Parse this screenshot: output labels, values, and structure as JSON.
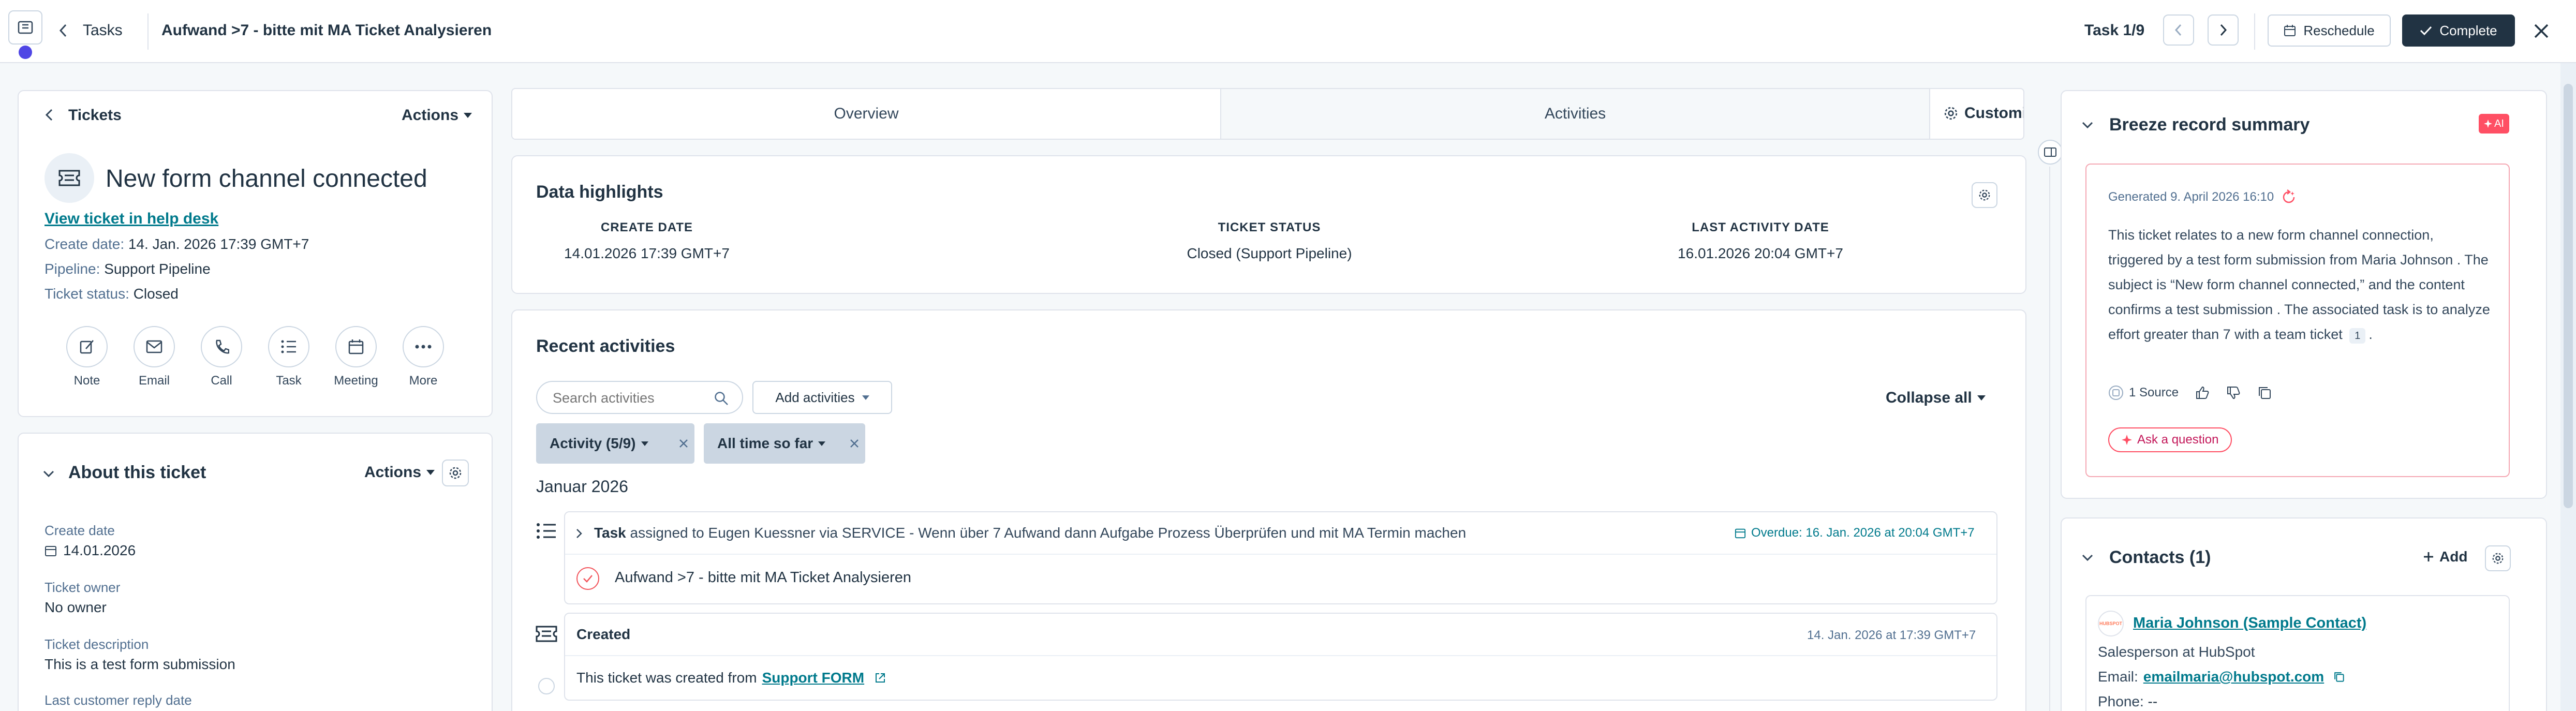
{
  "topbar": {
    "back_label": "Tasks",
    "task_title": "Aufwand >7 - bitte mit MA Ticket Analysieren",
    "task_counter": "Task 1/9",
    "reschedule_label": "Reschedule",
    "complete_label": "Complete"
  },
  "ticket_card": {
    "back_label": "Tickets",
    "actions_label": "Actions",
    "title": "New form channel connected",
    "help_desk_link": "View ticket in help desk",
    "create_date_label": "Create date:",
    "create_date_value": "14. Jan. 2026 17:39 GMT+7",
    "pipeline_label": "Pipeline:",
    "pipeline_value": "Support Pipeline",
    "status_label": "Ticket status:",
    "status_value": "Closed",
    "activities": [
      {
        "label": "Note",
        "icon": "note-icon"
      },
      {
        "label": "Email",
        "icon": "email-icon"
      },
      {
        "label": "Call",
        "icon": "call-icon"
      },
      {
        "label": "Task",
        "icon": "task-icon"
      },
      {
        "label": "Meeting",
        "icon": "meeting-icon"
      },
      {
        "label": "More",
        "icon": "more-icon"
      }
    ]
  },
  "about": {
    "title": "About this ticket",
    "actions_label": "Actions",
    "create_date_label": "Create date",
    "create_date_value": "14.01.2026",
    "owner_label": "Ticket owner",
    "owner_value": "No owner",
    "description_label": "Ticket description",
    "description_value": "This is a test form submission",
    "last_reply_label": "Last customer reply date"
  },
  "main": {
    "tabs": [
      "Overview",
      "Activities"
    ],
    "customize_label": "Customize",
    "highlights": {
      "title": "Data highlights",
      "items": [
        {
          "label": "CREATE DATE",
          "value": "14.01.2026 17:39 GMT+7"
        },
        {
          "label": "TICKET STATUS",
          "value": "Closed (Support Pipeline)"
        },
        {
          "label": "LAST ACTIVITY DATE",
          "value": "16.01.2026 20:04 GMT+7"
        }
      ]
    },
    "recent": {
      "title": "Recent activities",
      "search_placeholder": "Search activities",
      "add_label": "Add activities",
      "collapse_label": "Collapse all",
      "filter_activity": "Activity (5/9)",
      "filter_time": "All time so far",
      "month": "Januar 2026",
      "task_kind": "Task",
      "task_desc": "assigned to Eugen Kuessner via SERVICE - Wenn über 7 Aufwand dann Aufgabe Prozess Überprüfen und mit MA Termin machen",
      "task_due": "Overdue: 16. Jan. 2026 at 20:04 GMT+7",
      "task_name": "Aufwand >7 - bitte mit MA Ticket Analysieren",
      "created_title": "Created",
      "created_time": "14. Jan. 2026 at 17:39 GMT+7",
      "created_text": "This ticket was created from",
      "created_link": "Support FORM"
    }
  },
  "right": {
    "summary_title": "Breeze record summary",
    "ai_badge": "AI",
    "generated": "Generated 9. April 2026 16:10",
    "summary_text": "This ticket relates to a new form channel connection, triggered by a test form submission from Maria Johnson . The subject is “New form channel connected,” and the content confirms a test submission . The associated task is to analyze effort greater than 7 with a team ticket",
    "summary_badge": "1",
    "summary_end": ".",
    "source_label": "1 Source",
    "ask_label": "Ask a question",
    "contacts_title": "Contacts (1)",
    "add_label": "Add",
    "contact_avatar": "HUBSPOT",
    "contact_name": "Maria Johnson (Sample Contact)",
    "contact_role": "Salesperson at HubSpot",
    "email_label": "Email:",
    "email_value": "emailmaria@hubspot.com",
    "phone_label": "Phone:",
    "phone_value": "--"
  },
  "colors": {
    "accent_teal": "#007a8c",
    "dark_button": "#213343",
    "overdue": "#00a4bd",
    "ai_badge": "#ff4f64",
    "task_check": "#f2545b",
    "progress_dot": "#4f46e5"
  }
}
